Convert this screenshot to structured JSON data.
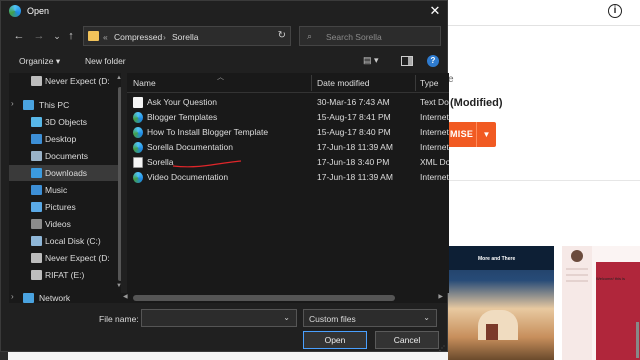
{
  "window": {
    "title": "Open",
    "close_glyph": "✕"
  },
  "nav": {
    "back": "←",
    "forward": "→",
    "recent": "⌄",
    "up": "↑"
  },
  "address": {
    "overflow": "«",
    "crumbs": [
      "Compressed",
      "Sorella"
    ],
    "separator": "›",
    "dropdown": "⌄",
    "refresh": "↻"
  },
  "search": {
    "placeholder": "Search Sorella",
    "icon": "⌕"
  },
  "toolbar": {
    "organize": "Organize ▾",
    "new_folder": "New folder",
    "view": "▤ ▾",
    "help": "?"
  },
  "navpane": {
    "items": [
      {
        "label": "Never Expect (D:",
        "icon": "drive-icon",
        "color": "#bdbdbd",
        "indent": 1,
        "selected": false
      },
      {
        "label": "This PC",
        "icon": "pc-icon",
        "color": "#4aa3e0",
        "indent": 0,
        "selected": false
      },
      {
        "label": "3D Objects",
        "icon": "cube-icon",
        "color": "#58b7e8",
        "indent": 1,
        "selected": false
      },
      {
        "label": "Desktop",
        "icon": "desktop-icon",
        "color": "#3d8fd6",
        "indent": 1,
        "selected": false
      },
      {
        "label": "Documents",
        "icon": "documents-icon",
        "color": "#9ab3c9",
        "indent": 1,
        "selected": false
      },
      {
        "label": "Downloads",
        "icon": "downloads-icon",
        "color": "#3b9be0",
        "indent": 1,
        "selected": true
      },
      {
        "label": "Music",
        "icon": "music-icon",
        "color": "#3d8fd6",
        "indent": 1,
        "selected": false
      },
      {
        "label": "Pictures",
        "icon": "pictures-icon",
        "color": "#5aa9e6",
        "indent": 1,
        "selected": false
      },
      {
        "label": "Videos",
        "icon": "videos-icon",
        "color": "#8c8c8c",
        "indent": 1,
        "selected": false
      },
      {
        "label": "Local Disk (C:)",
        "icon": "drive-icon",
        "color": "#8fb7d8",
        "indent": 1,
        "selected": false
      },
      {
        "label": "Never Expect (D:",
        "icon": "drive-icon",
        "color": "#bdbdbd",
        "indent": 1,
        "selected": false
      },
      {
        "label": "RIFAT (E:)",
        "icon": "drive-icon",
        "color": "#bdbdbd",
        "indent": 1,
        "selected": false
      },
      {
        "label": "Network",
        "icon": "network-icon",
        "color": "#4aa3e0",
        "indent": 0,
        "selected": false
      }
    ]
  },
  "list": {
    "columns": [
      "Name",
      "Date modified",
      "Type"
    ],
    "files": [
      {
        "name": "Ask Your Question",
        "date": "30-Mar-16 7:43 AM",
        "type": "Text Do",
        "icon": "text-file-icon"
      },
      {
        "name": "Blogger Templates",
        "date": "15-Aug-17 8:41 PM",
        "type": "Internet",
        "icon": "edge-shortcut-icon"
      },
      {
        "name": "How To Install Blogger Template",
        "date": "15-Aug-17 8:40 PM",
        "type": "Internet",
        "icon": "edge-shortcut-icon"
      },
      {
        "name": "Sorella Documentation",
        "date": "17-Jun-18 11:39 AM",
        "type": "Internet",
        "icon": "edge-shortcut-icon"
      },
      {
        "name": "Sorella",
        "date": "17-Jun-18 3:40 PM",
        "type": "XML Do",
        "icon": "xml-file-icon"
      },
      {
        "name": "Video Documentation",
        "date": "17-Jun-18 11:39 AM",
        "type": "Internet",
        "icon": "edge-shortcut-icon"
      }
    ]
  },
  "filename": {
    "label": "File name:",
    "value": "",
    "dropdown": "⌄"
  },
  "filter": {
    "value": "Custom files",
    "dropdown": "⌄"
  },
  "buttons": {
    "open": "Open",
    "cancel": "Cancel"
  },
  "background": {
    "heading_fragment": "e",
    "theme_title": "(Modified)",
    "buy_label": "MISE",
    "thumb1_title": "More and There",
    "thumb2_title": "Welcome/ this is"
  }
}
